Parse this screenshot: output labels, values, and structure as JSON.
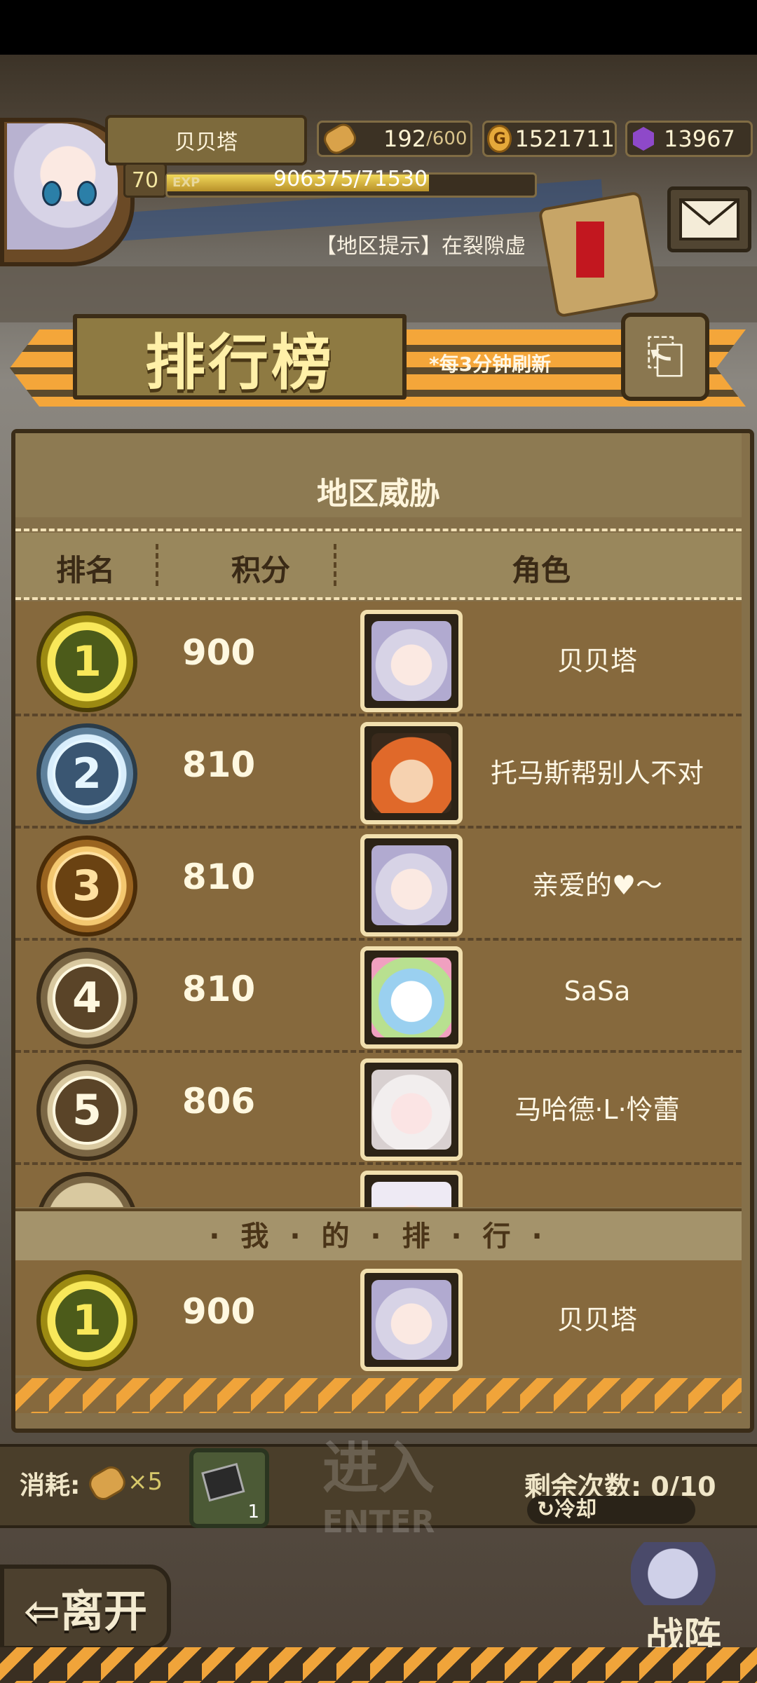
{
  "header": {
    "player_name": "贝贝塔",
    "level": "70",
    "exp_label": "EXP",
    "exp_text": "906375/71530",
    "exp_fraction": 0.72,
    "stamina": "192",
    "stamina_max": "/600",
    "gold": "1521711",
    "gem": "13967",
    "hint": "【地区提示】在裂隙虚"
  },
  "banner": {
    "title": "排行榜",
    "refresh_note": "*每3分钟刷新",
    "back_icon": "⎗"
  },
  "panel": {
    "title": "地区威胁",
    "columns": [
      "排名",
      "积分",
      "角色"
    ],
    "rows": [
      {
        "rank": "1",
        "score": "900",
        "name": "贝贝塔",
        "badge": "gold",
        "face": "lilac"
      },
      {
        "rank": "2",
        "score": "810",
        "name": "托马斯帮别人不对",
        "badge": "silver",
        "face": "orange"
      },
      {
        "rank": "3",
        "score": "810",
        "name": "亲爱的♥～",
        "badge": "bronze",
        "face": "lilac"
      },
      {
        "rank": "4",
        "score": "810",
        "name": "SaSa",
        "badge": "plain",
        "face": "rainbow"
      },
      {
        "rank": "5",
        "score": "806",
        "name": "马哈德·L·怜蕾",
        "badge": "plain",
        "face": "white"
      }
    ],
    "my_rank_label": "· 我 · 的 · 排 · 行 ·",
    "my_rank": {
      "rank": "1",
      "score": "900",
      "name": "贝贝塔"
    }
  },
  "footer": {
    "cost_label": "消耗:",
    "cost_value": "×5",
    "item_count": "1",
    "enter_cn": "进入",
    "enter_en": "ENTER",
    "remaining": "剩余次数: 0/10",
    "cooldown": "↻冷却",
    "leave": "⇦离开",
    "formation": "战阵"
  },
  "colors": {
    "panel": "#86693d",
    "accent_orange": "#f0a43a",
    "text_light": "#fff8e0"
  }
}
